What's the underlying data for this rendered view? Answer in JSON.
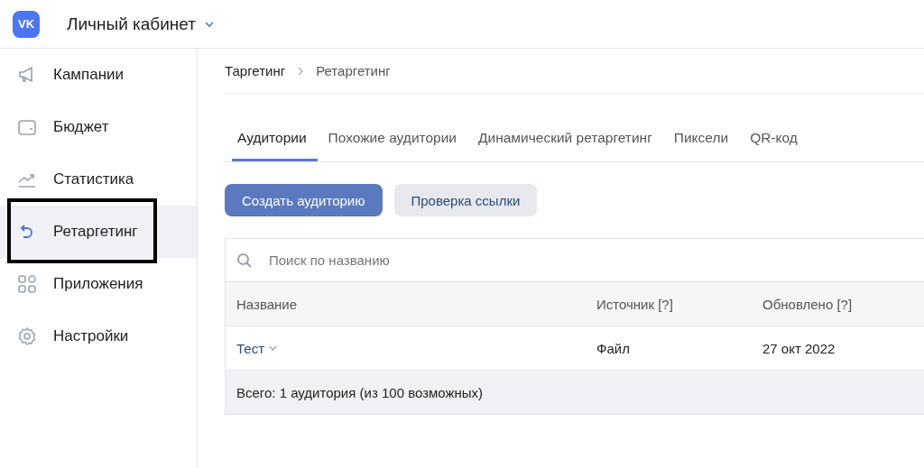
{
  "header": {
    "logo": "VK",
    "title": "Личный кабинет"
  },
  "sidebar": {
    "items": [
      {
        "label": "Кампании",
        "selected": false,
        "highlighted": false
      },
      {
        "label": "Бюджет",
        "selected": false,
        "highlighted": false
      },
      {
        "label": "Статистика",
        "selected": false,
        "highlighted": false
      },
      {
        "label": "Ретаргетинг",
        "selected": true,
        "highlighted": true
      },
      {
        "label": "Приложения",
        "selected": false,
        "highlighted": false
      },
      {
        "label": "Настройки",
        "selected": false,
        "highlighted": false
      }
    ]
  },
  "breadcrumbs": [
    "Таргетинг",
    "Ретаргетинг"
  ],
  "tabs": [
    {
      "label": "Аудитории",
      "selected": true
    },
    {
      "label": "Похожие аудитории",
      "selected": false
    },
    {
      "label": "Динамический ретаргетинг",
      "selected": false
    },
    {
      "label": "Пиксели",
      "selected": false
    },
    {
      "label": "QR-код",
      "selected": false
    }
  ],
  "buttons": [
    {
      "label": "Создать аудиторию",
      "kind": "primary"
    },
    {
      "label": "Проверка ссылки",
      "kind": "secondary"
    }
  ],
  "search": {
    "placeholder": "Поиск по названию"
  },
  "table": {
    "columns": [
      "Название",
      "Источник [?]",
      "Обновлено [?]"
    ],
    "rows": [
      [
        "Тест",
        "Файл",
        "27 окт 2022"
      ]
    ],
    "footer": "Всего: 1 аудитория (из 100 возможных)"
  }
}
